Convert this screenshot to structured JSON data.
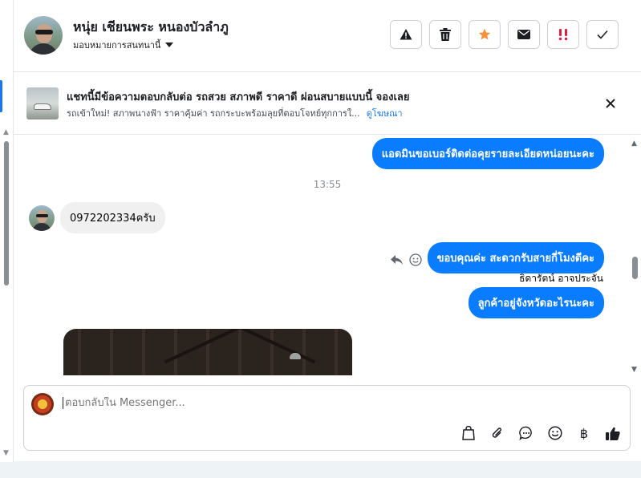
{
  "header": {
    "contact_name": "หนุ่ย เชียนพระ หนองบัวลำภู",
    "assign_label": "มอบหมายการสนทนานี้",
    "actions": [
      {
        "name": "report-spam-button",
        "icon": "warning-icon"
      },
      {
        "name": "delete-button",
        "icon": "trash-icon"
      },
      {
        "name": "star-button",
        "icon": "star-icon",
        "color": "#f7923a"
      },
      {
        "name": "mark-unread-button",
        "icon": "mail-icon"
      },
      {
        "name": "follow-up-button",
        "icon": "priority-icon",
        "color": "#e41e3f"
      },
      {
        "name": "mark-done-button",
        "icon": "check-icon"
      }
    ]
  },
  "ad": {
    "title": "แชทนี้มีข้อความตอบกลับต่อ รถสวย สภาพดี ราคาดี ผ่อนสบายแบบนี้ จองเลย",
    "subtitle": "รถเข้าใหม่! สภาพนางฟ้า ราคาคุ้มค่า รถกระบะพร้อมลุยที่ตอบโจทย์ทุกการใ...",
    "link": "ดูโฆษณา"
  },
  "messages": {
    "out_1": "แอดมินขอเบอร์ติดต่อคุยรายละเอียดหน่อยนะคะ",
    "timestamp": "13:55",
    "in_1": "0972202334ครับ",
    "out_2": "ขอบคุณค่ะ สะดวกรับสายกี่โมงดีคะ",
    "sender": "ธิดารัตน์ อาจประจัน",
    "out_3": "ลูกค้าอยู่จังหวัดอะไรนะคะ"
  },
  "composer": {
    "placeholder": "ตอบกลับใน Messenger..."
  },
  "colors": {
    "outgoing_bubble": "#0a7cff",
    "incoming_bubble": "#f0f0f0",
    "link": "#1877f2"
  }
}
